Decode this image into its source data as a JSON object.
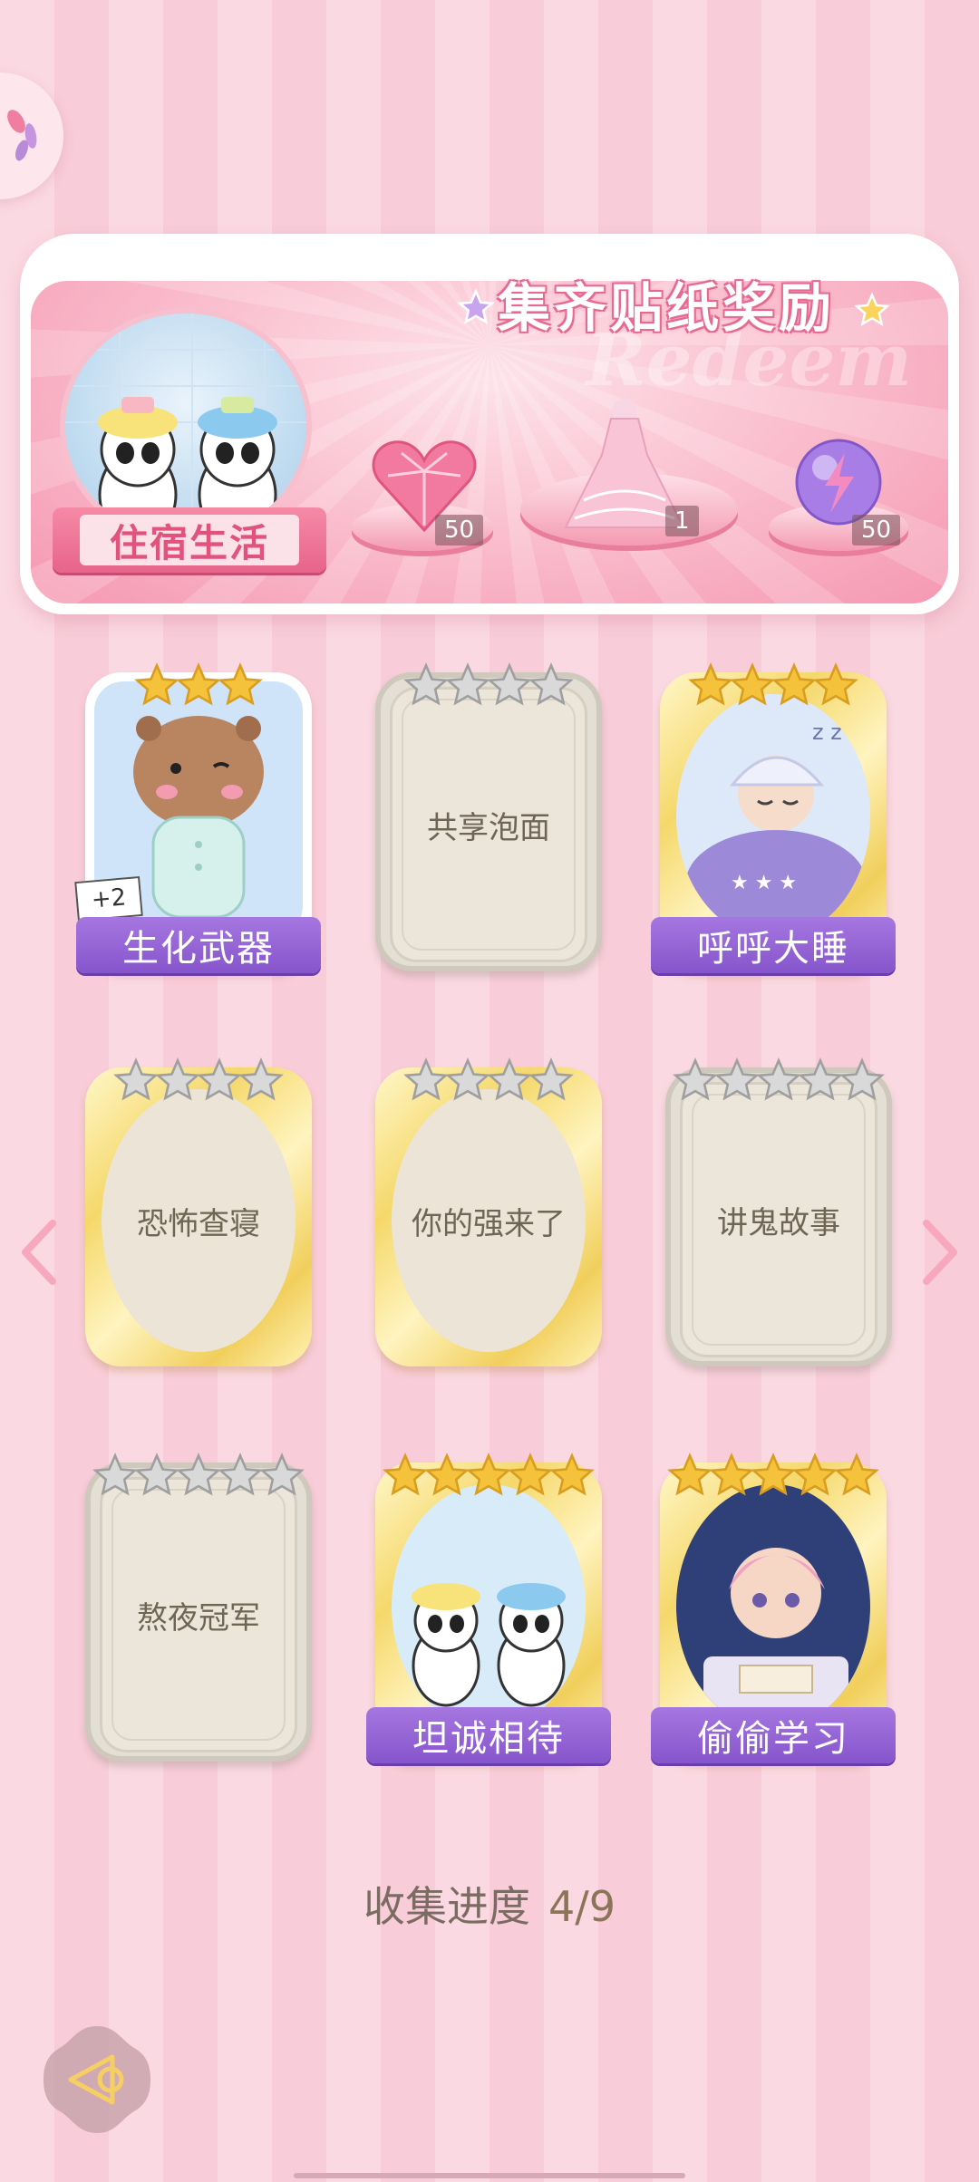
{
  "banner": {
    "title": "集齐贴纸奖励",
    "watermark": "Redeem",
    "theme_label": "住宿生活",
    "rewards": [
      {
        "icon": "heart-gem-icon",
        "qty": "50"
      },
      {
        "icon": "pink-dress-icon",
        "qty": "1"
      },
      {
        "icon": "energy-orb-icon",
        "qty": "50"
      }
    ]
  },
  "cards": [
    {
      "label": "生化武器",
      "stars": "3",
      "collected": true,
      "badge": "+2"
    },
    {
      "label": "共享泡面",
      "stars": "4",
      "collected": false
    },
    {
      "label": "呼呼大睡",
      "stars": "4",
      "collected": true
    },
    {
      "label": "恐怖查寝",
      "stars": "4",
      "collected": false
    },
    {
      "label": "你的强来了",
      "stars": "4",
      "collected": false
    },
    {
      "label": "讲鬼故事",
      "stars": "5",
      "collected": false
    },
    {
      "label": "熬夜冠军",
      "stars": "5",
      "collected": false
    },
    {
      "label": "坦诚相待",
      "stars": "5",
      "collected": true
    },
    {
      "label": "偷偷学习",
      "stars": "5",
      "collected": true
    }
  ],
  "progress": {
    "label": "收集进度",
    "value": "4/9"
  },
  "colors": {
    "accent_pink": "#e7648a",
    "card_banner": "#8655cc",
    "gold_star": "#f5c33b",
    "silver_star": "#c9c9c9"
  }
}
